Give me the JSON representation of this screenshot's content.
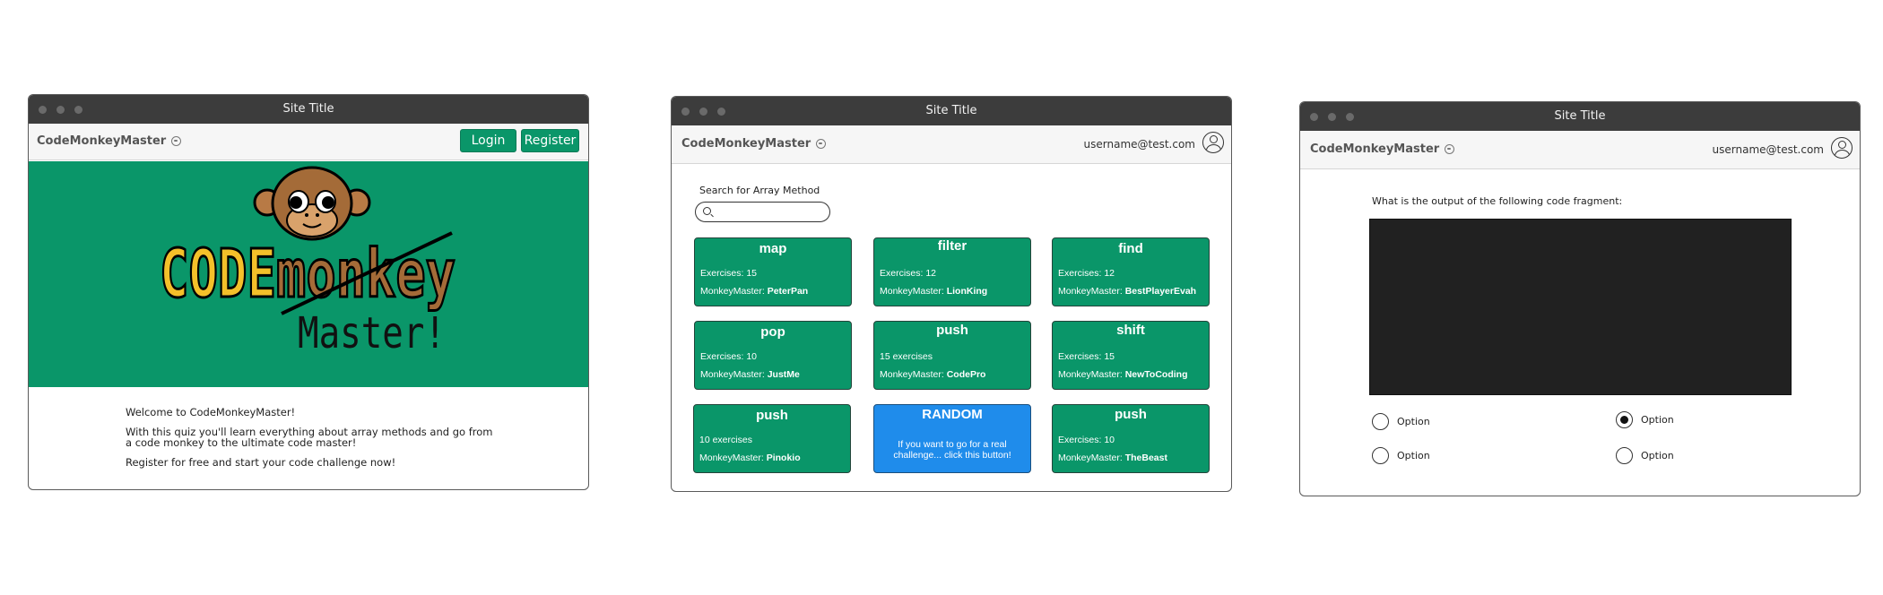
{
  "window1": {
    "title": "Site Title",
    "brand": "CodeMonkeyMaster",
    "login_label": "Login",
    "register_label": "Register",
    "logo_text": {
      "code": "CODE",
      "monkey": "monkey",
      "master": "Master!"
    },
    "welcome": [
      "Welcome to CodeMonkeyMaster!",
      "With this quiz you'll learn everything about array methods and go from a code monkey to the ultimate code master!",
      "Register for free and start your code challenge now!"
    ]
  },
  "window2": {
    "title": "Site Title",
    "brand": "CodeMonkeyMaster",
    "user_email": "username@test.com",
    "search_label": "Search for Array Method",
    "search_value": "",
    "cards": [
      {
        "name": "map",
        "exercises": "Exercises: 15",
        "master_prefix": "MonkeyMaster: ",
        "master": "PeterPan"
      },
      {
        "name": "filter",
        "exercises": "Exercises: 12",
        "master_prefix": "MonkeyMaster: ",
        "master": "LionKing"
      },
      {
        "name": "find",
        "exercises": "Exercises: 12",
        "master_prefix": "MonkeyMaster: ",
        "master": "BestPlayerEvah"
      },
      {
        "name": "pop",
        "exercises": "Exercises: 10",
        "master_prefix": "MonkeyMaster: ",
        "master": "JustMe"
      },
      {
        "name": "push",
        "exercises": "15 exercises",
        "master_prefix": "MonkeyMaster: ",
        "master": "CodePro"
      },
      {
        "name": "shift",
        "exercises": "Exercises: 15",
        "master_prefix": "MonkeyMaster: ",
        "master": "NewToCoding"
      },
      {
        "name": "push",
        "exercises": "10 exercises",
        "master_prefix": "MonkeyMaster: ",
        "master": "Pinokio"
      },
      {
        "name": "RANDOM",
        "description": "If you want to go for a real challenge... click this button!"
      },
      {
        "name": "push",
        "exercises": "Exercises: 10",
        "master_prefix": "MonkeyMaster: ",
        "master": "TheBeast"
      }
    ],
    "colors": {
      "card": "#0a9669",
      "random": "#1f8ceb"
    }
  },
  "window3": {
    "title": "Site Title",
    "brand": "CodeMonkeyMaster",
    "user_email": "username@test.com",
    "question": "What is the output of the following code fragment:",
    "options": [
      {
        "label": "Option",
        "selected": false
      },
      {
        "label": "Option",
        "selected": true
      },
      {
        "label": "Option",
        "selected": false
      },
      {
        "label": "Option",
        "selected": false
      }
    ]
  }
}
